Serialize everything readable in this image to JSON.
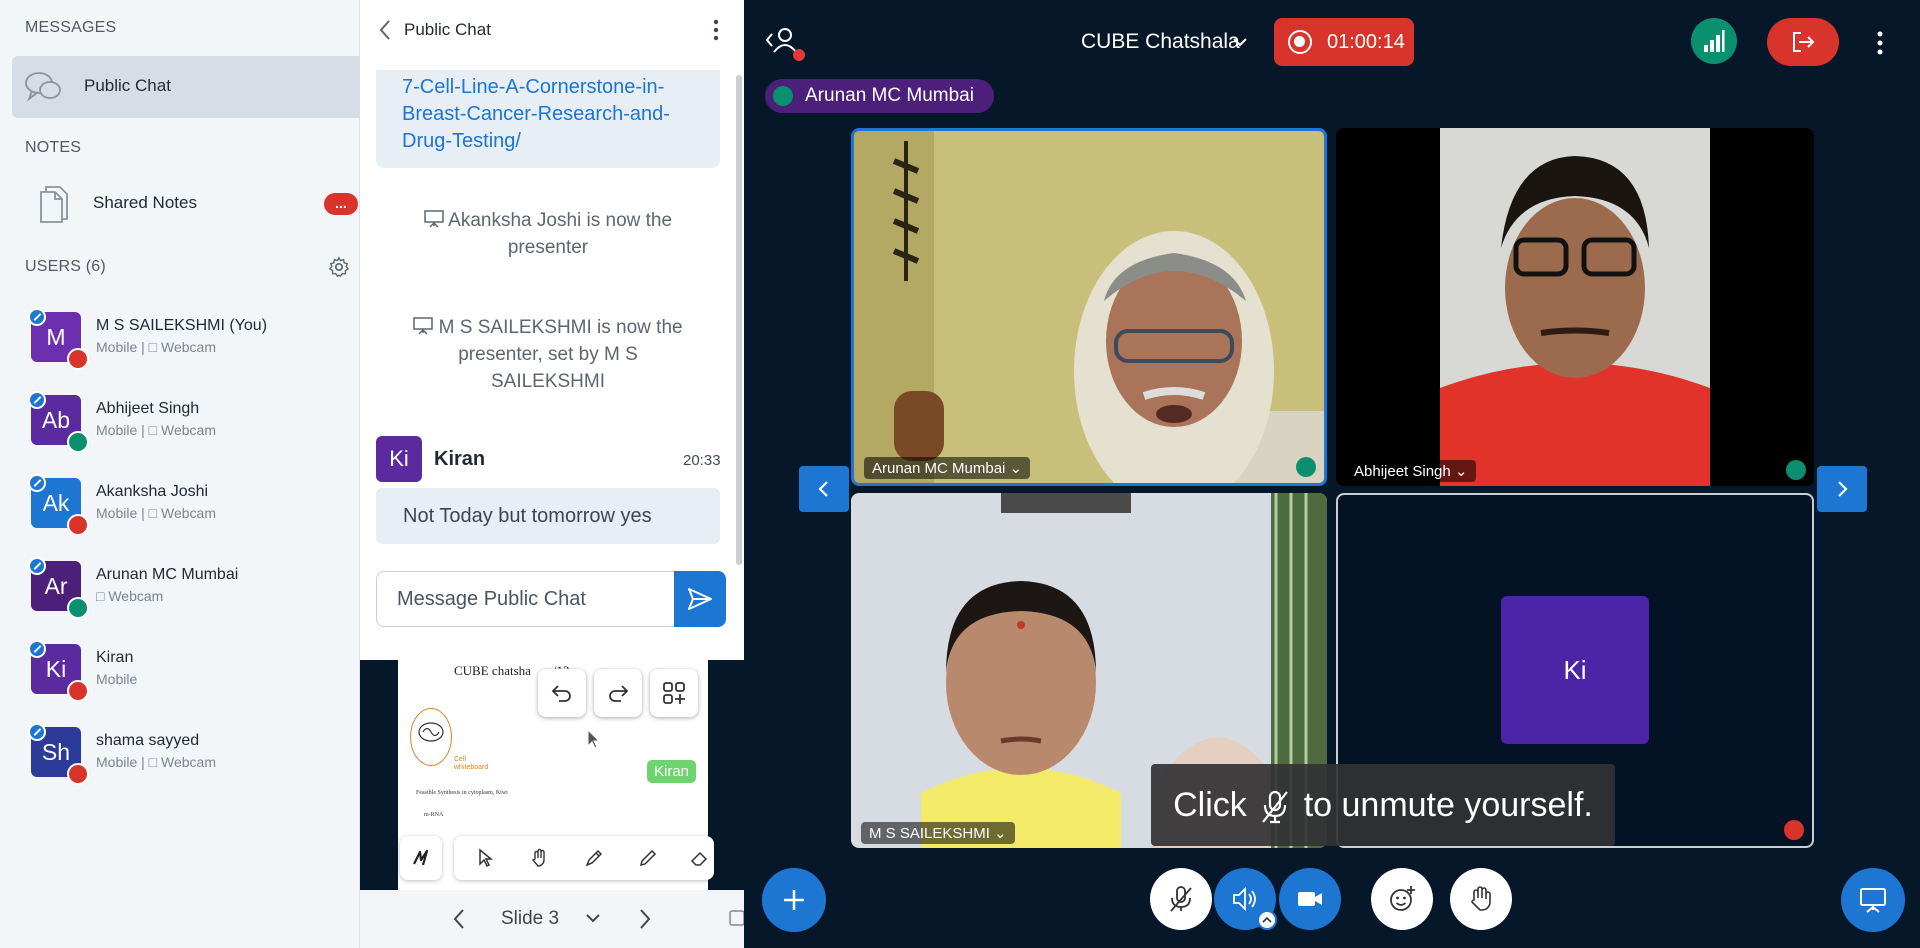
{
  "left_panel": {
    "messages_title": "MESSAGES",
    "public_chat_label": "Public Chat",
    "notes_title": "NOTES",
    "shared_notes_label": "Shared Notes",
    "notes_badge": "...",
    "users_title": "USERS (6)",
    "users": [
      {
        "initials": "M",
        "name": "M S SAILEKSHMI (You)",
        "sub": "Mobile | □ Webcam",
        "color": "#6b2fb0",
        "presenter_badge": true,
        "mic": "muted"
      },
      {
        "initials": "Ab",
        "name": "Abhijeet Singh",
        "sub": "Mobile | □ Webcam",
        "color": "#5b2a9f",
        "presenter_badge": true,
        "mic": "on"
      },
      {
        "initials": "Ak",
        "name": "Akanksha Joshi",
        "sub": "Mobile | □ Webcam",
        "color": "#1c76d2",
        "presenter_badge": true,
        "mic": "muted"
      },
      {
        "initials": "Ar",
        "name": "Arunan MC Mumbai",
        "sub": "□ Webcam",
        "color": "#4b1f7a",
        "presenter_badge": true,
        "mic": "on"
      },
      {
        "initials": "Ki",
        "name": "Kiran",
        "sub": "Mobile",
        "color": "#5b2a9f",
        "presenter_badge": true,
        "mic": "muted"
      },
      {
        "initials": "Sh",
        "name": "shama sayyed",
        "sub": "Mobile | □ Webcam",
        "color": "#2c3a9a",
        "presenter_badge": true,
        "mic": "muted"
      }
    ]
  },
  "chat": {
    "title": "Public Chat",
    "link_lines": [
      "7-Cell-Line-A-Cornerstone-in-",
      "Breast-Cancer-Research-and-",
      "Drug-Testing/"
    ],
    "system_messages": [
      "Akanksha Joshi is now the presenter",
      "M S SAILEKSHMI is now the presenter, set by M S SAILEKSHMI"
    ],
    "last_message": {
      "initials": "Ki",
      "name": "Kiran",
      "time": "20:33",
      "text": "Not Today but tomorrow yes"
    },
    "input_placeholder": "Message Public Chat"
  },
  "presentation": {
    "slide_title": "CUBE chatsha",
    "slide_title_suffix": "/12",
    "logo_text_1": "Cell",
    "logo_text_2": "whiteboard",
    "slide_line_1": "Feasible Synthesis in cytoplasm, Kiwi",
    "slide_line_2": "m-RNA",
    "cursor_label": "Kiran",
    "slide_label": "Slide 3"
  },
  "meeting": {
    "title": "CUBE Chatshala",
    "record_time": "01:00:14",
    "talking_indicator": "Arunan MC Mumbai",
    "tiles": [
      {
        "name": "Arunan MC Mumbai",
        "mic": "on"
      },
      {
        "name": "Abhijeet Singh",
        "mic": "on"
      },
      {
        "name": "M S SAILEKSHMI",
        "mic": "muted"
      },
      {
        "name": "Kiran",
        "initials": "Ki",
        "mic": "muted"
      }
    ],
    "toast_before": "Click",
    "toast_after": "to unmute yourself."
  },
  "colors": {
    "brand_blue": "#1c76d2",
    "danger_red": "#d9342b",
    "success_green": "#0a8f6f",
    "background_navy": "#06172a"
  }
}
